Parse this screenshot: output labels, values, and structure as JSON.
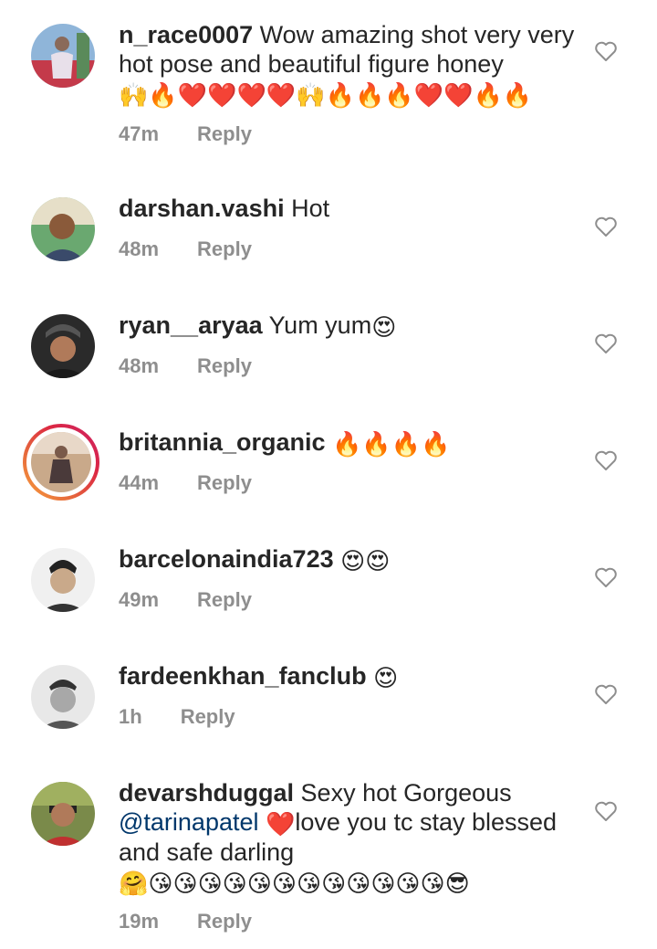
{
  "comments": [
    {
      "username": "n_race0007",
      "text": " Wow amazing shot very very hot pose and beautiful figure honey",
      "emojis": "🙌🔥❤️❤️❤️❤️🙌🔥🔥🔥❤️❤️🔥🔥",
      "time": "47m",
      "reply": "Reply"
    },
    {
      "username": "darshan.vashi",
      "text": " Hot",
      "emojis": "",
      "time": "48m",
      "reply": "Reply"
    },
    {
      "username": "ryan__aryaa",
      "text": " Yum yum",
      "emojis": "😍",
      "time": "48m",
      "reply": "Reply"
    },
    {
      "username": "britannia_organic",
      "text": " ",
      "emojis": "🔥🔥🔥🔥",
      "time": "44m",
      "reply": "Reply"
    },
    {
      "username": "barcelonaindia723",
      "text": " ",
      "emojis": "😍😍",
      "time": "49m",
      "reply": "Reply"
    },
    {
      "username": "fardeenkhan_fanclub",
      "text": " ",
      "emojis": "😍",
      "time": "1h",
      "reply": "Reply"
    },
    {
      "username": "devarshduggal",
      "text": " Sexy hot Gorgeous",
      "mention": "@tarinapatel",
      "text2": "love you tc stay blessed and safe darling",
      "emoji_mid": "❤️",
      "emojis": "🤗😘😘😘😘😘😘😘😘😘😘😘😘😎",
      "time": "19m",
      "reply": "Reply"
    }
  ],
  "icons": {
    "like": "heart-outline-icon"
  },
  "colors": {
    "secondary": "#8e8e8e",
    "mention": "#00376b",
    "ring_start": "#f9a23b",
    "ring_end": "#cc2366"
  }
}
